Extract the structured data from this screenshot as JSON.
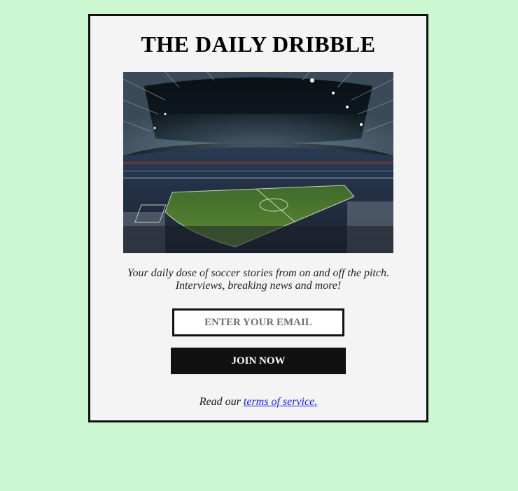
{
  "newsletter": {
    "title": "THE DAILY DRIBBLE",
    "tagline_line1": "Your daily dose of soccer stories from on and off the pitch.",
    "tagline_line2": "Interviews, breaking news and more!",
    "email_placeholder": "ENTER YOUR EMAIL",
    "join_label": "JOIN NOW",
    "tos_prefix": "Read our ",
    "tos_link": "terms of service."
  },
  "colors": {
    "page_background": "#cdf7d0",
    "card_background": "#f4f4f4",
    "border": "#111111",
    "button": "#111111",
    "link": "#1a1ae6"
  }
}
